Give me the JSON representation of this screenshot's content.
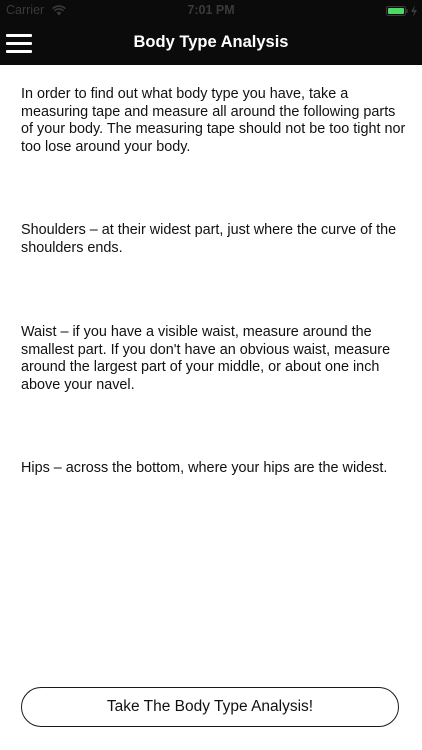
{
  "status_bar": {
    "carrier": "Carrier",
    "time": "7:01 PM"
  },
  "header": {
    "title": "Body Type Analysis",
    "menu_icon": "hamburger-menu-icon"
  },
  "content": {
    "paragraphs": [
      "In order to find out what body type you have, take a measuring tape and measure all around the following parts of your body. The measuring tape should not be too tight nor too lose around your body.",
      "Shoulders – at their widest part, just where the curve of the shoulders ends.",
      "Waist – if you have a visible waist, measure around the smallest part. If you don't have an obvious waist, measure around the largest part of your middle, or about one inch above your navel.",
      "Hips – across the bottom, where your hips are the widest."
    ]
  },
  "footer": {
    "button_label": "Take The Body Type Analysis!"
  },
  "colors": {
    "nav_background": "#0b0b0c",
    "battery": "#4cd964"
  }
}
